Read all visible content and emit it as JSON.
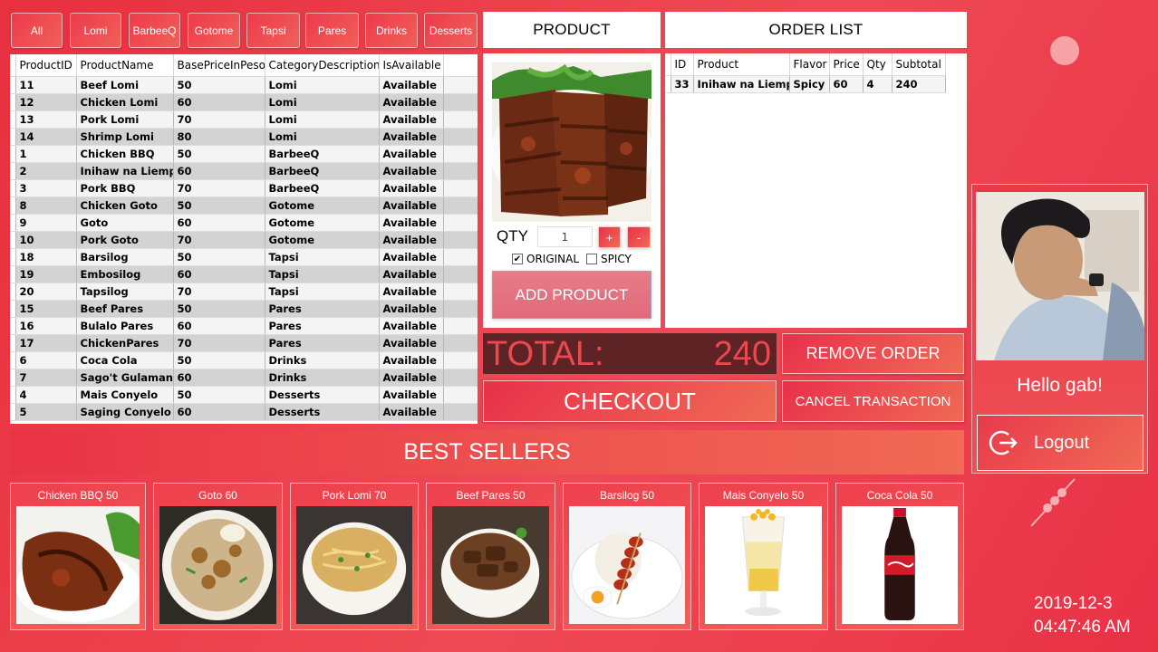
{
  "categories": [
    "All",
    "Lomi",
    "BarbeeQ",
    "Gotome",
    "Tapsi",
    "Pares",
    "Drinks",
    "Desserts"
  ],
  "product_grid": {
    "columns": [
      "ProductID",
      "ProductName",
      "BasePriceInPeso",
      "CategoryDescription",
      "IsAvailable"
    ],
    "rows": [
      [
        "11",
        "Beef Lomi",
        "50",
        "Lomi",
        "Available"
      ],
      [
        "12",
        "Chicken Lomi",
        "60",
        "Lomi",
        "Available"
      ],
      [
        "13",
        "Pork Lomi",
        "70",
        "Lomi",
        "Available"
      ],
      [
        "14",
        "Shrimp Lomi",
        "80",
        "Lomi",
        "Available"
      ],
      [
        "1",
        "Chicken BBQ",
        "50",
        "BarbeeQ",
        "Available"
      ],
      [
        "2",
        "Inihaw na Liempo",
        "60",
        "BarbeeQ",
        "Available"
      ],
      [
        "3",
        "Pork BBQ",
        "70",
        "BarbeeQ",
        "Available"
      ],
      [
        "8",
        "Chicken Goto",
        "50",
        "Gotome",
        "Available"
      ],
      [
        "9",
        "Goto",
        "60",
        "Gotome",
        "Available"
      ],
      [
        "10",
        "Pork Goto",
        "70",
        "Gotome",
        "Available"
      ],
      [
        "18",
        "Barsilog",
        "50",
        "Tapsi",
        "Available"
      ],
      [
        "19",
        "Embosilog",
        "60",
        "Tapsi",
        "Available"
      ],
      [
        "20",
        "Tapsilog",
        "70",
        "Tapsi",
        "Available"
      ],
      [
        "15",
        "Beef Pares",
        "50",
        "Pares",
        "Available"
      ],
      [
        "16",
        "Bulalo Pares",
        "60",
        "Pares",
        "Available"
      ],
      [
        "17",
        "ChickenPares",
        "70",
        "Pares",
        "Available"
      ],
      [
        "6",
        "Coca Cola",
        "50",
        "Drinks",
        "Available"
      ],
      [
        "7",
        "Sago't Gulaman",
        "60",
        "Drinks",
        "Available"
      ],
      [
        "4",
        "Mais Conyelo",
        "50",
        "Desserts",
        "Available"
      ],
      [
        "5",
        "Saging Conyelo",
        "60",
        "Desserts",
        "Available"
      ]
    ]
  },
  "product_panel": {
    "header": "PRODUCT",
    "qty_label": "QTY",
    "qty_value": "1",
    "plus_label": "+",
    "minus_label": "-",
    "original_label": "ORIGINAL",
    "original_checked": true,
    "spicy_label": "SPICY",
    "spicy_checked": false,
    "add_label": "ADD PRODUCT"
  },
  "order_panel": {
    "header": "ORDER LIST",
    "columns": [
      "ID",
      "Product",
      "Flavor",
      "Price",
      "Qty",
      "Subtotal"
    ],
    "rows": [
      [
        "33",
        "Inihaw na Liempo",
        "Spicy",
        "60",
        "4",
        "240"
      ]
    ]
  },
  "totals": {
    "total_label": "TOTAL:",
    "total_value": "240",
    "remove_label": "REMOVE ORDER",
    "checkout_label": "CHECKOUT",
    "cancel_label": "CANCEL TRANSACTION"
  },
  "best_sellers": {
    "title": "BEST SELLERS",
    "items": [
      {
        "label": "Chicken BBQ 50",
        "icon": "chicken-bbq-photo"
      },
      {
        "label": "Goto 60",
        "icon": "goto-photo"
      },
      {
        "label": "Pork Lomi 70",
        "icon": "pork-lomi-photo"
      },
      {
        "label": "Beef Pares 50",
        "icon": "beef-pares-photo"
      },
      {
        "label": "Barsilog 50",
        "icon": "barsilog-photo"
      },
      {
        "label": "Mais Conyelo 50",
        "icon": "mais-conyelo-photo"
      },
      {
        "label": "Coca Cola 50",
        "icon": "coca-cola-photo"
      }
    ]
  },
  "user": {
    "greeting": "Hello gab!",
    "logout_label": "Logout"
  },
  "datetime": {
    "date": "2019-12-3",
    "time": "04:47:46 AM"
  },
  "colors": {
    "accent": "#e8303f",
    "total_bg": "#5e2325",
    "total_text": "#e84a50"
  }
}
